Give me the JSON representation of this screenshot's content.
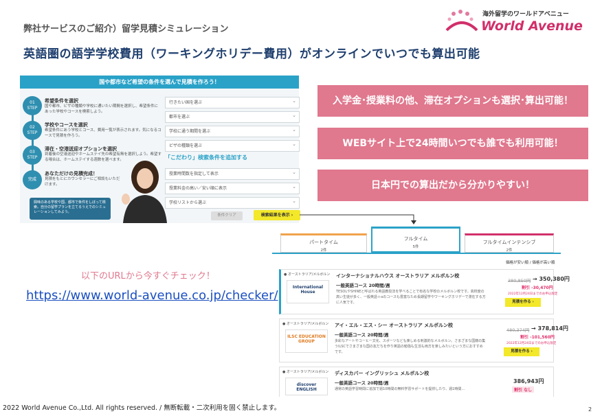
{
  "header": {
    "subtitle": "弊社サービスのご紹介）留学見積シミュレーション",
    "title": "英語圏の語学学校費用（ワーキングホリデー費用）がオンラインでいつでも算出可能"
  },
  "logo": {
    "tagline": "海外留学のワールドアベニュー",
    "name": "World Avenue"
  },
  "left_panel": {
    "bar_text": "国や都市など希望の条件を選んで見積を作ろう！",
    "steps": [
      {
        "num": "01",
        "label": "STEP",
        "title": "希望条件を選択",
        "desc": "国や都市、ビザの種類や学校に通いたい期間を選択し、希望条件にあった学校やコースを検索しよう。"
      },
      {
        "num": "02",
        "label": "STEP",
        "title": "学校やコースを選択",
        "desc": "希望条件にあう学校とコース、費用一覧が表示されます。気になるコースで見積を作ろう。"
      },
      {
        "num": "03",
        "label": "STEP",
        "title": "滞在・空港送迎オプションを選択",
        "desc": "到着後の空港送迎やホームステイ先の希望有無を選択しよう。希望する場合は、ホームステイする週数を選べます。"
      },
      {
        "num": "",
        "label": "完成",
        "title": "あなただけの見積完成！",
        "desc": "見積をもとにカウンセラーにご相談もいただけます。"
      }
    ],
    "callout": "興味のある学校や国、都市で条件をしぼって検索。自分の留学プランを立てるうえでのシミュレーションしてみよう。",
    "selects": [
      "行きたい国を選ぶ",
      "都市を選ぶ",
      "学校に通う期間を選ぶ",
      "ビザの種類を選ぶ"
    ],
    "kodawari": "「こだわり」検索条件を追加する",
    "extra_selects": [
      "授業時間数を指定して表示",
      "授業料金の高い／安い順に表示",
      "学校リストから選ぶ"
    ],
    "clear_btn": "条件クリア",
    "search_btn": "検索結果を表示 ›"
  },
  "banners": [
    "入学金･授業料の他、滞在オプションも選択･算出可能！",
    "WEBサイト上で24時間いつでも誰でも利用可能！",
    "日本円での算出だから分かりやすい！"
  ],
  "tabs": [
    {
      "label": "パートタイム",
      "count": "2件"
    },
    {
      "label": "フルタイム",
      "count": "5件"
    },
    {
      "label": "フルタイムインテンシブ",
      "count": "2件"
    }
  ],
  "sort": "価格が安い順 / 価格が高い順",
  "url_section": {
    "note": "以下のURLから今すぐチェック！",
    "url": "https://www.world-avenue.co.jp/checker/"
  },
  "cards": [
    {
      "flag": "● オーストラリア/メルボルン",
      "logo": "International House",
      "title": "インターナショナルハウス オーストラリア メルボルン校",
      "course": "一般英語コース 20時間/週",
      "desc": "TESOLやSHINEと呼ばれる英語教授法を学べることで有名な学校のメルボルン校です。高校度の高い生徒が多く、一般英語＋αのコースも豊富なため長期留学やワーキングホリデーで滞在する方に人気です。",
      "price_old": "380,850円",
      "price": "→ 350,380円",
      "discount": "割引 -30,470円",
      "date": "2022年12月24日までのお申込限定",
      "btn": "見積を作る ›"
    },
    {
      "flag": "● オーストラリア/メルボルン",
      "logo": "ILSC EDUCATION GROUP",
      "title": "アイ・エル・エス・シー オーストラリア メルボルン校",
      "course": "一般英語コース 20時間/週",
      "desc": "多彩なアートやコーヒー文化、スポーツなども楽しめる刺激的なメルボルン。さまざまな国籍の集うILSCでさまざまな国の友だちを作り英語の勉強も生活も両方を楽しみたいという方におすすめです。",
      "price_old": "480,374円",
      "price": "→ 378,814円",
      "discount": "割引 -101,560円",
      "date": "2022年12月24日までのお申込限定",
      "btn": "見積を作る ›"
    },
    {
      "flag": "● オーストラリア/メルボルン",
      "logo": "discover ENGLISH",
      "title": "ディスカバー イングリッシュ メルボルン校",
      "course": "一般英語コース 20時間/週",
      "desc": "通常の英語学習時間に追加で週10時間の無料学習サポートを提供したり、週1時間…",
      "price_old": "",
      "price": "386,943円",
      "discount": "割引 なし",
      "date": "",
      "btn": ""
    }
  ],
  "footer": "2022 World Avenue Co.,Ltd. All rights reserved. / 無断転載・二次利用を固く禁止します。",
  "page_number": "2"
}
